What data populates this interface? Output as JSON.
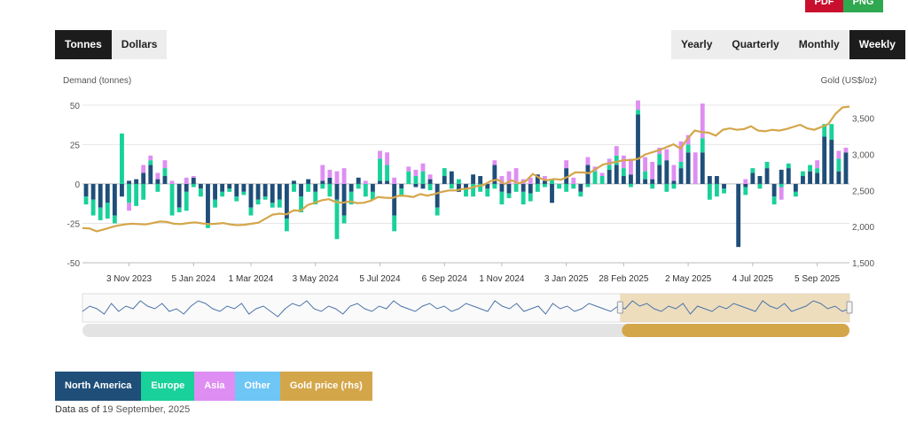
{
  "export": {
    "pdf_label": "PDF",
    "png_label": "PNG"
  },
  "unit_toggle": [
    {
      "label": "Tonnes",
      "active": true
    },
    {
      "label": "Dollars",
      "active": false
    }
  ],
  "period_toggle": [
    {
      "label": "Yearly",
      "active": false
    },
    {
      "label": "Quarterly",
      "active": false
    },
    {
      "label": "Monthly",
      "active": false
    },
    {
      "label": "Weekly",
      "active": true
    }
  ],
  "legend": [
    {
      "label": "North America",
      "color": "#1f4e79"
    },
    {
      "label": "Europe",
      "color": "#19d19a"
    },
    {
      "label": "Asia",
      "color": "#de8ef2"
    },
    {
      "label": "Other",
      "color": "#6ec6f5"
    },
    {
      "label": "Gold price (rhs)",
      "color": "#d4a64a"
    }
  ],
  "data_as_of": {
    "prefix": "Data as of",
    "date": "19 September, 2025"
  },
  "chart_data": {
    "type": "bar",
    "stacked": true,
    "ylabel": "Demand (tonnes)",
    "y2label": "Gold (US$/oz)",
    "ylim": [
      -50,
      60
    ],
    "y2lim": [
      1500,
      3900
    ],
    "yticks": [
      -50,
      -25,
      0,
      25,
      50
    ],
    "y2ticks": [
      "1,500",
      "2,000",
      "2,500",
      "3,000",
      "3,500"
    ],
    "x_tick_labels": [
      "3 Nov 2023",
      "5 Jan 2024",
      "1 Mar 2024",
      "3 May 2024",
      "5 Jul 2024",
      "6 Sep 2024",
      "1 Nov 2024",
      "3 Jan 2025",
      "28 Feb 2025",
      "2 May 2025",
      "4 Jul 2025",
      "5 Sep 2025"
    ],
    "x_tick_week_index": [
      6,
      15,
      23,
      32,
      41,
      50,
      58,
      67,
      75,
      84,
      93,
      102
    ],
    "grid": true,
    "legend_position": "bottom",
    "series": [
      {
        "name": "North America",
        "color": "#1f4e79",
        "values": [
          -8,
          -10,
          -15,
          -12,
          -20,
          -8,
          2,
          3,
          7,
          12,
          3,
          5,
          0,
          -15,
          -5,
          4,
          -3,
          -25,
          -10,
          -5,
          -3,
          -8,
          -5,
          -15,
          -10,
          -8,
          -12,
          -10,
          -22,
          2,
          -8,
          3,
          -5,
          2,
          4,
          -10,
          -20,
          -5,
          4,
          0,
          -5,
          2,
          2,
          -20,
          -3,
          0,
          -2,
          -3,
          3,
          -15,
          5,
          8,
          -5,
          -3,
          6,
          5,
          -3,
          12,
          -5,
          -6,
          0,
          -5,
          -6,
          6,
          2,
          -12,
          0,
          10,
          0,
          -5,
          12,
          0,
          0,
          9,
          12,
          5,
          6,
          44,
          3,
          3,
          12,
          15,
          2,
          10,
          20,
          0,
          20,
          5,
          5,
          -3,
          0,
          -40,
          -2,
          7,
          5,
          10,
          -8,
          9,
          10,
          -5,
          5,
          8,
          7,
          30,
          28,
          8,
          20
        ]
      },
      {
        "name": "Europe",
        "color": "#19d19a",
        "values": [
          -5,
          -10,
          -8,
          -10,
          -5,
          32,
          -12,
          -14,
          -10,
          3,
          -5,
          5,
          -20,
          -3,
          -12,
          -2,
          -5,
          -3,
          -5,
          -3,
          -2,
          -3,
          -2,
          -5,
          -3,
          -2,
          -3,
          -5,
          -8,
          -5,
          -10,
          -5,
          -8,
          -3,
          -8,
          -25,
          -5,
          -8,
          -3,
          -8,
          -5,
          14,
          10,
          -10,
          -5,
          8,
          5,
          8,
          -4,
          -5,
          5,
          -3,
          3,
          -5,
          -8,
          -5,
          -5,
          -3,
          -8,
          -3,
          -5,
          -8,
          -5,
          -5,
          -2,
          3,
          -3,
          -5,
          -3,
          -3,
          -2,
          8,
          5,
          3,
          6,
          5,
          -2,
          3,
          5,
          -3,
          7,
          -5,
          -3,
          4,
          5,
          0,
          9,
          -10,
          -8,
          -3,
          0,
          0,
          -5,
          3,
          -3,
          4,
          -5,
          -2,
          3,
          -3,
          3,
          4,
          3,
          8,
          10,
          8,
          0
        ]
      },
      {
        "name": "Asia",
        "color": "#de8ef2",
        "values": [
          0,
          0,
          0,
          0,
          0,
          0,
          -5,
          0,
          5,
          3,
          4,
          5,
          2,
          0,
          4,
          1,
          0,
          0,
          0,
          0,
          0,
          0,
          0,
          0,
          0,
          0,
          0,
          0,
          0,
          0,
          0,
          0,
          0,
          10,
          5,
          8,
          10,
          0,
          0,
          2,
          0,
          5,
          8,
          4,
          0,
          3,
          4,
          5,
          3,
          0,
          0,
          0,
          0,
          0,
          0,
          0,
          0,
          3,
          5,
          8,
          10,
          3,
          4,
          0,
          3,
          0,
          0,
          5,
          4,
          0,
          5,
          3,
          2,
          4,
          6,
          8,
          10,
          6,
          9,
          11,
          4,
          7,
          10,
          13,
          6,
          20,
          22,
          0,
          0,
          0,
          0,
          0,
          3,
          0,
          0,
          0,
          0,
          -8,
          0,
          0,
          0,
          0,
          5,
          0,
          0,
          5,
          3
        ]
      },
      {
        "name": "Other",
        "color": "#6ec6f5",
        "values": [
          0,
          0,
          0,
          0,
          0,
          0,
          0,
          0,
          0,
          0,
          0,
          0,
          0,
          0,
          0,
          0,
          0,
          0,
          0,
          0,
          0,
          0,
          0,
          0,
          0,
          0,
          0,
          0,
          0,
          0,
          0,
          0,
          0,
          0,
          0,
          0,
          0,
          0,
          0,
          0,
          0,
          0,
          0,
          0,
          0,
          0,
          0,
          0,
          0,
          0,
          0,
          0,
          0,
          0,
          0,
          0,
          0,
          0,
          0,
          0,
          0,
          0,
          0,
          0,
          0,
          0,
          0,
          0,
          0,
          0,
          0,
          0,
          0,
          0,
          0,
          0,
          0,
          0,
          0,
          0,
          0,
          0,
          0,
          0,
          0,
          0,
          0,
          0,
          0,
          0,
          0,
          0,
          0,
          0,
          0,
          0,
          0,
          0,
          0,
          0,
          0,
          0,
          0,
          0,
          0,
          0
        ]
      },
      {
        "name": "Gold price (rhs)",
        "type": "line",
        "axis": "right",
        "color": "#d4a64a",
        "values": [
          1980,
          1975,
          1935,
          1960,
          1990,
          2015,
          2030,
          2040,
          2035,
          2030,
          2050,
          2070,
          2065,
          2040,
          2035,
          2050,
          2060,
          2045,
          2035,
          2040,
          2050,
          2030,
          2020,
          2025,
          2040,
          2055,
          2110,
          2165,
          2180,
          2170,
          2225,
          2220,
          2300,
          2330,
          2365,
          2380,
          2340,
          2330,
          2350,
          2325,
          2330,
          2360,
          2410,
          2400,
          2395,
          2430,
          2425,
          2410,
          2450,
          2430,
          2450,
          2480,
          2500,
          2500,
          2520,
          2530,
          2560,
          2575,
          2630,
          2650,
          2590,
          2640,
          2600,
          2630,
          2730,
          2670,
          2640,
          2660,
          2650,
          2690,
          2750,
          2750,
          2740,
          2800,
          2860,
          2880,
          2900,
          2920,
          2920,
          2940,
          3000,
          3030,
          3060,
          3100,
          3140,
          3080,
          3220,
          3330,
          3310,
          3300,
          3260,
          3340,
          3360,
          3340,
          3350,
          3390,
          3330,
          3320,
          3340,
          3330,
          3350,
          3380,
          3410,
          3360,
          3340,
          3380,
          3420,
          3560,
          3650,
          3660
        ]
      }
    ],
    "navigator": {
      "values": [
        34,
        36,
        35,
        33,
        37,
        34,
        36,
        35,
        38,
        36,
        35,
        37,
        34,
        35,
        33,
        36,
        38,
        37,
        35,
        34,
        36,
        35,
        37,
        33,
        35,
        36,
        34,
        32,
        35,
        37,
        36,
        38,
        35,
        34,
        36,
        35,
        33,
        36,
        37,
        35,
        34,
        36,
        35,
        38,
        36,
        35,
        34,
        36,
        37,
        35,
        36,
        34,
        35,
        37,
        36,
        35,
        34,
        38,
        36,
        35,
        37,
        34,
        35,
        36,
        33,
        37,
        35,
        36,
        34,
        35,
        37,
        36,
        35,
        34,
        36,
        35,
        38,
        36,
        37,
        35,
        34,
        36,
        35,
        37,
        33,
        36,
        35,
        34,
        36,
        35,
        37,
        36,
        35,
        34,
        38,
        36,
        35,
        37,
        34,
        35,
        36,
        38,
        37,
        35,
        36,
        34,
        35
      ],
      "selected_range": [
        "28 Feb 2025",
        "5 Sep 2025"
      ]
    }
  }
}
